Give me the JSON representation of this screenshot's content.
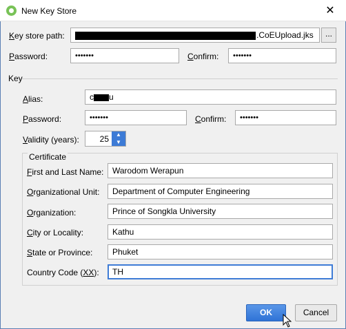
{
  "window": {
    "title": "New Key Store",
    "close_glyph": "✕"
  },
  "keystore": {
    "path_label_u": "K",
    "path_label_rest": "ey store path:",
    "path_visible_suffix": ".CoEUpload.jks",
    "browse_label": "...",
    "password_label_u": "P",
    "password_label_rest": "assword:",
    "password_value": "•••••••",
    "confirm_label_u": "C",
    "confirm_label_rest": "onfirm:",
    "confirm_value": "•••••••"
  },
  "key": {
    "section_label": "Key",
    "alias_label_u": "A",
    "alias_label_rest": "lias:",
    "alias_prefix": "c",
    "alias_suffix": "u",
    "password_label_u": "P",
    "password_label_rest": "assword:",
    "password_value": "•••••••",
    "confirm_label_u": "C",
    "confirm_label_rest": "onfirm:",
    "confirm_value": "•••••••",
    "validity_label_u": "V",
    "validity_label_rest": "alidity (years):",
    "validity_value": "25"
  },
  "certificate": {
    "legend": "Certificate",
    "fields": [
      {
        "label_u": "F",
        "label_rest": "irst and Last Name:",
        "value": "Warodom Werapun"
      },
      {
        "label_u": "O",
        "label_rest": "rganizational Unit:",
        "value": "Department of Computer Engineering"
      },
      {
        "label_u": "O",
        "label_rest": "rganization:",
        "value": "Prince of Songkla University"
      },
      {
        "label_u": "C",
        "label_rest": "ity or Locality:",
        "value": "Kathu"
      },
      {
        "label_u": "S",
        "label_rest": "tate or Province:",
        "value": "Phuket"
      },
      {
        "label_pre": "Country Code (",
        "label_u": "XX",
        "label_post": "):",
        "value": "TH"
      }
    ]
  },
  "buttons": {
    "ok": "OK",
    "cancel": "Cancel"
  },
  "colors": {
    "accent": "#3d7bd6",
    "app_icon": "#78c257"
  }
}
